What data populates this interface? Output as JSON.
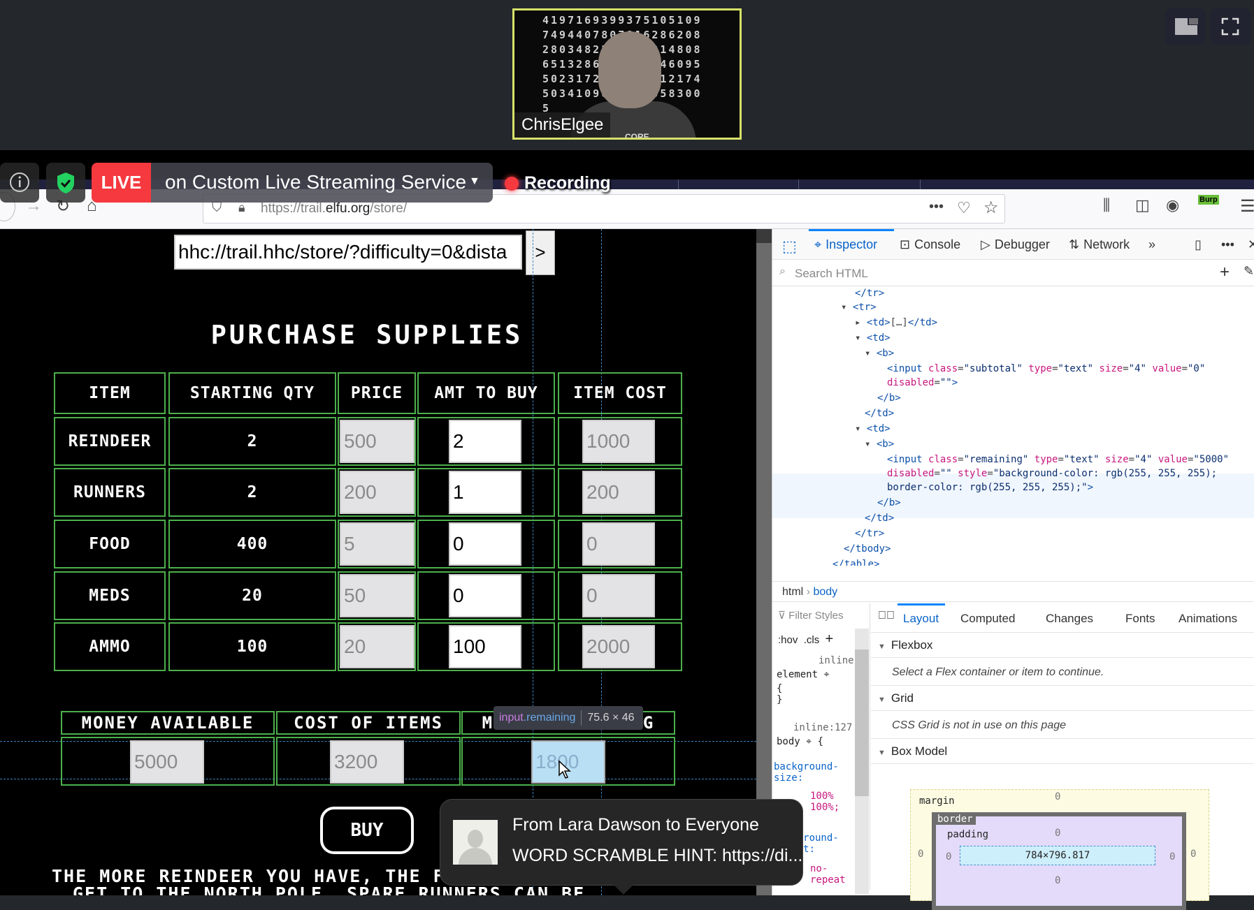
{
  "meeting": {
    "participant_name": "ChrisElgee",
    "video_bg_digits": "4197169399375105109749440780781628620828034825342132148086513286470938446095502317253594081217450341096405960583005",
    "shirt_text": "CORE",
    "live_badge": "LIVE",
    "live_text": "on Custom Live Streaming Service",
    "recording_label": "Recording"
  },
  "browser": {
    "url_prefix": "https://trail.",
    "url_domain": "elfu.org",
    "url_suffix": "/store/",
    "burp_label": "Burp"
  },
  "game": {
    "url_value": "hhc://trail.hhc/store/?difficulty=0&dista",
    "go_label": ">",
    "title": "PURCHASE SUPPLIES",
    "headers": [
      "ITEM",
      "STARTING QTY",
      "PRICE",
      "AMT TO BUY",
      "ITEM COST"
    ],
    "rows": [
      {
        "item": "REINDEER",
        "qty": "2",
        "price": "500",
        "amt": "2",
        "cost": "1000"
      },
      {
        "item": "RUNNERS",
        "qty": "2",
        "price": "200",
        "amt": "1",
        "cost": "200"
      },
      {
        "item": "FOOD",
        "qty": "400",
        "price": "5",
        "amt": "0",
        "cost": "0"
      },
      {
        "item": "MEDS",
        "qty": "20",
        "price": "50",
        "amt": "0",
        "cost": "0"
      },
      {
        "item": "AMMO",
        "qty": "100",
        "price": "20",
        "amt": "100",
        "cost": "2000"
      }
    ],
    "summary_headers": [
      "MONEY AVAILABLE",
      "COST OF ITEMS",
      "MONEY REMAINING"
    ],
    "summary_values": {
      "money_available": "5000",
      "cost_of_items": "3200",
      "money_remaining": "1800"
    },
    "buy_label": "BUY",
    "message_line1": "THE MORE REINDEER YOU HAVE, THE FASTER YOU",
    "message_line2": "GET TO THE NORTH POLE. SPARE RUNNERS CAN BE"
  },
  "inspector_tooltip": {
    "tag": "input",
    "class": ".remaining",
    "size": "75.6 × 46"
  },
  "chat": {
    "from": "From Lara Dawson to Everyone",
    "text": "WORD SCRAMBLE HINT: https://di..."
  },
  "devtools": {
    "tabs": [
      "Inspector",
      "Console",
      "Debugger",
      "Network"
    ],
    "search_placeholder": "Search HTML",
    "breadcrumb": [
      "html",
      "body"
    ],
    "side_tabs": [
      "Layout",
      "Computed",
      "Changes",
      "Fonts",
      "Animations"
    ],
    "filter_placeholder": "Filter Styles",
    "pseudo_buttons": [
      ":hov",
      ".cls"
    ],
    "rules": {
      "inline_label": "inline",
      "element_selector": "element",
      "body_source": "inline:127",
      "body_selector": "body",
      "prop1": "background-size:",
      "val1": "100% 100%;",
      "prop2": "background-repeat:",
      "val2": "no-repeat"
    },
    "flexbox_title": "Flexbox",
    "flexbox_msg": "Select a Flex container or item to continue.",
    "grid_title": "Grid",
    "grid_msg": "CSS Grid is not in use on this page",
    "boxmodel_title": "Box Model",
    "box": {
      "margin_label": "margin",
      "border_label": "border",
      "padding_label": "padding",
      "content": "784×796.817",
      "zero": "0"
    }
  }
}
